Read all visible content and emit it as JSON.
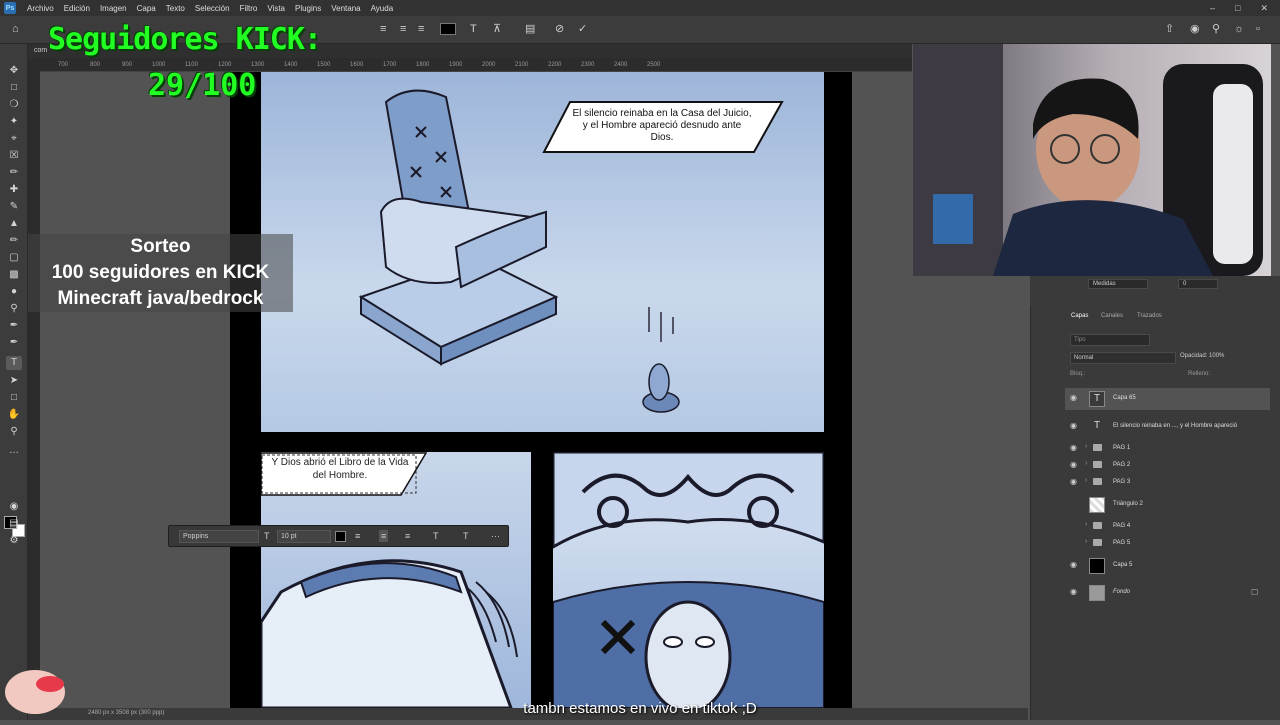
{
  "menubar": {
    "logo": "Ps",
    "items": [
      "Archivo",
      "Edición",
      "Imagen",
      "Capa",
      "Texto",
      "Selección",
      "Filtro",
      "Vista",
      "Plugins",
      "Ventana",
      "Ayuda"
    ]
  },
  "doc": {
    "tab_label": "com",
    "ruler_ticks": [
      "700",
      "800",
      "900",
      "1000",
      "1100",
      "1200",
      "1300",
      "1400",
      "1500",
      "1600",
      "1700",
      "1800",
      "1900",
      "2000",
      "2100",
      "2200",
      "2300",
      "2400",
      "2500"
    ],
    "status": "2480 px x 3508 px (300 ppp)"
  },
  "comic": {
    "caption_top": "El silencio reinaba en la Casa del Juicio, y el Hombre apareció desnudo ante Dios.",
    "caption_edit": "Y Dios abrió el Libro de la Vida del Hombre."
  },
  "context_bar": {
    "font": "Poppins",
    "size": "10 pt",
    "more": "···"
  },
  "overlays": {
    "kick_title": "Seguidores KICK:",
    "kick_count": "29/100",
    "sorteo_line1": "Sorteo",
    "sorteo_line2": "100 seguidores en KICK",
    "sorteo_line3": "Minecraft java/bedrock",
    "subtitle": "tambn estamos en vivo en tiktok ;D"
  },
  "properties": {
    "units": "Medidas",
    "value": "0"
  },
  "layers_panel": {
    "tabs": [
      "Capas",
      "Canales",
      "Trazados"
    ],
    "search_placeholder": "Tipo",
    "blend_mode": "Normal",
    "opacity_label": "Opacidad:",
    "opacity_value": "100%",
    "lock_label": "Bloq.:",
    "fill_label": "Relleno:",
    "layers": [
      {
        "name": "Capa 65",
        "kind": "text",
        "visible": true,
        "selected": true
      },
      {
        "name": "El silencio reinaba en ..., y el Hombre apareció",
        "kind": "text",
        "visible": true
      },
      {
        "name": "PAG 1",
        "kind": "group",
        "visible": true
      },
      {
        "name": "PAG 2",
        "kind": "group",
        "visible": true
      },
      {
        "name": "PAG 3",
        "kind": "group",
        "visible": true
      },
      {
        "name": "Triángulo 2",
        "kind": "image",
        "visible": false
      },
      {
        "name": "PAG 4",
        "kind": "group",
        "visible": false
      },
      {
        "name": "PAG 5",
        "kind": "group",
        "visible": false
      },
      {
        "name": "Capa 5",
        "kind": "black",
        "visible": true
      },
      {
        "name": "Fondo",
        "kind": "gray",
        "visible": true,
        "locked": true
      }
    ]
  },
  "colors": {
    "kick_green": "#22ff22",
    "ps_blue": "#2b6fb3",
    "comic_blue": "#9db5d9"
  }
}
